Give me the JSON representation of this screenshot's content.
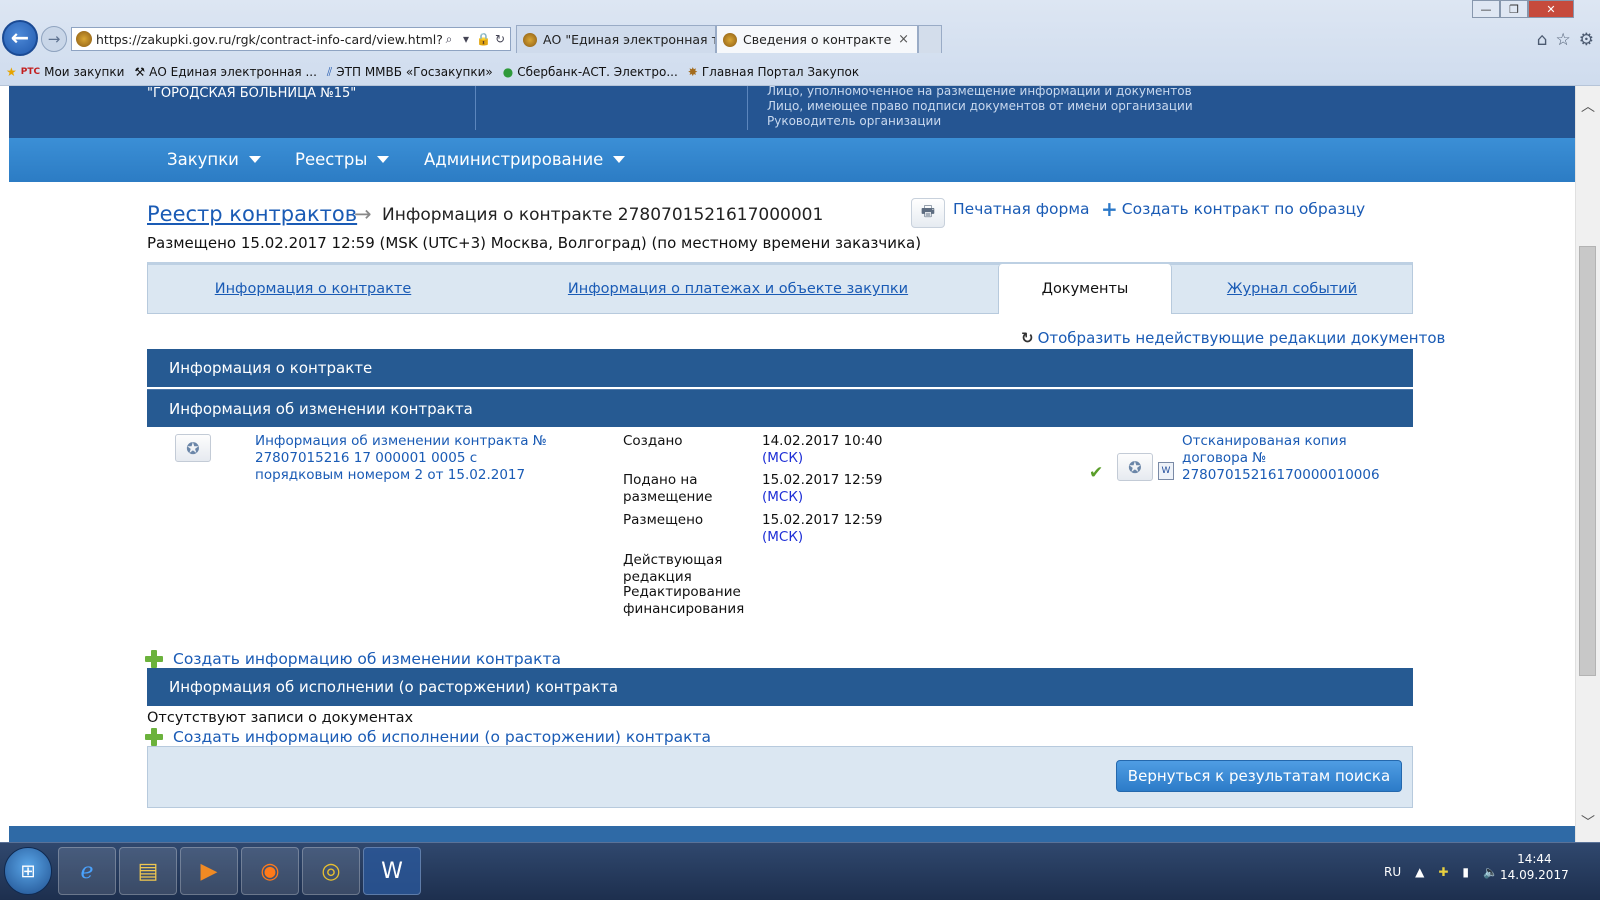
{
  "browser": {
    "url": "https://zakupki.gov.ru/rgk/contract-info-card/view.html?contrac",
    "tabs": [
      {
        "title": "АО \"Единая электронная торг..."
      },
      {
        "title": "Сведения о контракте",
        "close": "×"
      }
    ],
    "favorites": [
      {
        "icon_text": "РТС",
        "label": "Мои закупки"
      },
      {
        "label": "АО Единая электронная ..."
      },
      {
        "label": "ЭТП ММВБ «Госзакупки»"
      },
      {
        "label": "Сбербанк-АСТ. Электро..."
      },
      {
        "label": "Главная Портал Закупок"
      }
    ]
  },
  "org": {
    "name": "\"ГОРОДСКАЯ БОЛЬНИЦА №15\"",
    "roles": [
      "Лицо, уполномоченное на размещение информации и документов",
      "Лицо, имеющее право подписи документов от имени организации",
      "Руководитель организации"
    ]
  },
  "nav": {
    "items": [
      "Закупки",
      "Реестры",
      "Администрирование"
    ]
  },
  "page": {
    "breadcrumb_registry": "Реестр контрактов",
    "breadcrumb_arrow": "→",
    "title": "Информация о контракте 2780701521617000001",
    "posted": "Размещено 15.02.2017 12:59 (MSK (UTC+3) Москва, Волгоград) (по местному времени заказчика)",
    "print_label": "Печатная форма",
    "create_copy_label": "Создать контракт по образцу",
    "tabs": [
      "Информация о контракте",
      "Информация о платежах и объекте закупки",
      "Документы",
      "Журнал событий"
    ],
    "active_tab": "Документы",
    "show_inactive": "Отобразить недействующие редакции документов"
  },
  "sections": {
    "contract_info": "Информация о контракте",
    "change_info": "Информация об изменении контракта",
    "execution_info": "Информация об исполнении (о расторжении) контракта"
  },
  "change_row": {
    "link": "Информация об изменении контракта № 27807015216 17 000001 0005 с порядковым номером 2 от 15.02.2017",
    "created_label": "Создано",
    "created_value": "14.02.2017 10:40",
    "submitted_label": "Подано на размещение",
    "submitted_value": "15.02.2017 12:59",
    "posted_label": "Размещено",
    "posted_value": "15.02.2017 12:59",
    "tz": "(МСК)",
    "status_1": "Действующая редакция",
    "status_2": "Редактирование финансирования",
    "scan_link": "Отсканированая копия договора № 27807015216170000010006"
  },
  "actions": {
    "add_change": "Создать информацию об изменении контракта",
    "no_records": "Отсутствуют записи о документах",
    "add_execution": "Создать информацию об исполнении (о расторжении) контракта",
    "back_to_results": "Вернуться к результатам поиска"
  },
  "taskbar": {
    "lang": "RU",
    "time": "14:44",
    "date": "14.09.2017"
  },
  "colors": {
    "header_blue": "#255592",
    "nav_blue": "#3b8fd6",
    "link_blue": "#1a5bb5",
    "panel_bg": "#dbe7f2"
  }
}
